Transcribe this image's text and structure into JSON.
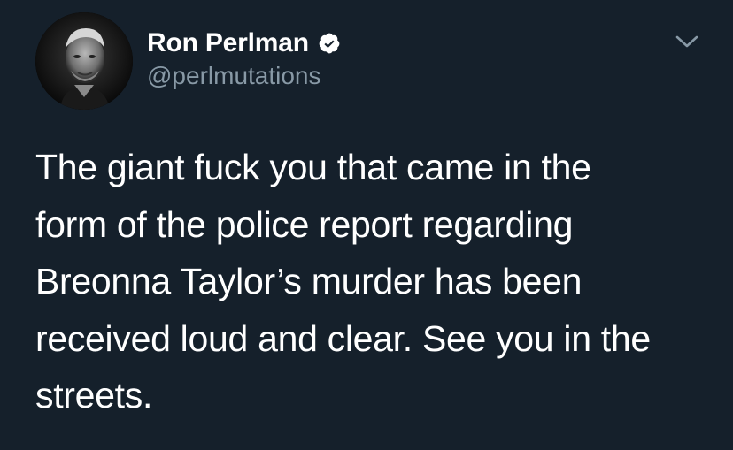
{
  "author": {
    "display_name": "Ron Perlman",
    "handle": "@perlmutations",
    "verified": true
  },
  "icons": {
    "verified": "verified-badge-icon",
    "more": "chevron-down-icon"
  },
  "colors": {
    "background": "#15202b",
    "text": "#ffffff",
    "secondary_text": "#8899a6"
  },
  "tweet": {
    "lines": [
      "The giant fuck you that came in the",
      "form of the police report regarding",
      "Breonna Taylor’s murder has been",
      "received loud and clear. See you in the",
      "streets."
    ]
  }
}
